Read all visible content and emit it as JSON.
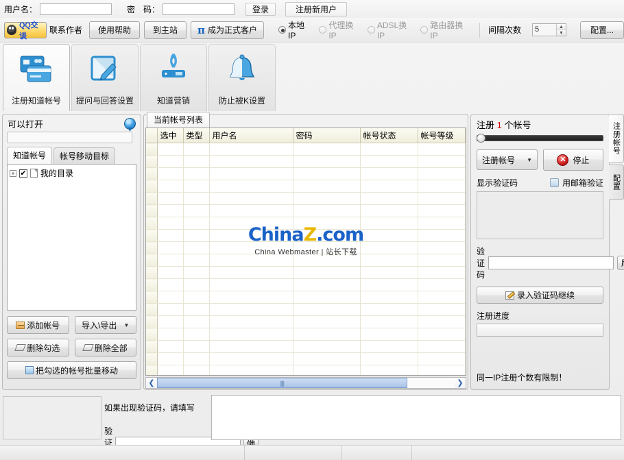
{
  "login": {
    "username_label": "用户名：",
    "username_value": "",
    "password_label": "密　码：",
    "password_value": "",
    "login_button": "登录",
    "register_button": "注册新用户"
  },
  "toolbar": {
    "qq_label": "QQ交谈",
    "contact_author": "联系作者",
    "help": "使用帮助",
    "main_site": "到主站",
    "become_client": "成为正式客户",
    "pi_symbol": "π",
    "ip_options": [
      {
        "label": "本地IP",
        "selected": true,
        "enabled": true
      },
      {
        "label": "代理换IP",
        "selected": false,
        "enabled": false
      },
      {
        "label": "ADSL换IP",
        "selected": false,
        "enabled": false
      },
      {
        "label": "路由器换IP",
        "selected": false,
        "enabled": false
      }
    ],
    "interval_label": "间隔次数",
    "interval_value": "5",
    "config_button": "配置..."
  },
  "main_tabs": [
    {
      "label": "注册知道帐号",
      "icon": "cards-icon",
      "active": true
    },
    {
      "label": "提问与回答设置",
      "icon": "note-pencil-icon",
      "active": false
    },
    {
      "label": "知道营销",
      "icon": "router-signal-icon",
      "active": false
    },
    {
      "label": "防止被K设置",
      "icon": "bell-icon",
      "active": false
    }
  ],
  "left_panel": {
    "title": "可以打开",
    "globe_icon": "globe-icon",
    "search_value": "",
    "subtabs": [
      {
        "label": "知道帐号",
        "active": true
      },
      {
        "label": "帐号移动目标",
        "active": false
      }
    ],
    "tree": [
      {
        "label": "我的目录",
        "checked": true,
        "expandable": true
      }
    ],
    "buttons": {
      "add_account": "添加帐号",
      "import_export": "导入\\导出",
      "delete_checked": "删除勾选",
      "delete_all": "删除全部",
      "batch_move": "把勾选的帐号批量移动"
    }
  },
  "center_panel": {
    "tab_label": "当前帐号列表",
    "columns": [
      "选中",
      "类型",
      "用户名",
      "密码",
      "帐号状态",
      "帐号等级"
    ],
    "rows": [],
    "watermark": {
      "brand_part1": "China",
      "brand_part2": "Z",
      "brand_part3": ".com",
      "subtitle": "China Webmaster | 站长下载"
    }
  },
  "right_panel": {
    "title_prefix": "注册",
    "title_count": "1",
    "title_suffix": "个帐号",
    "slider_value": 0,
    "action_select": "注册帐号",
    "stop_button": "停止",
    "show_captcha_label": "显示验证码",
    "email_verify_label": "用邮箱验证",
    "email_verify_checked": false,
    "captcha_label": "验证码",
    "captcha_value": "",
    "refresh_button": "刷",
    "continue_button": "录入验证码继续",
    "progress_label": "注册进度",
    "progress_value": "",
    "note": "同一IP注册个数有限制！"
  },
  "vertical_tabs": [
    {
      "label": "注册帐号",
      "active": true
    },
    {
      "label": "配置",
      "active": false
    }
  ],
  "bottom": {
    "hint": "如果出现验证码，请填写",
    "captcha_label": "验证码",
    "captcha_value": "",
    "ok_button": "确"
  },
  "colors": {
    "accent_blue": "#1a62c7",
    "brand_yellow": "#e8b800",
    "stop_red": "#cf1f1f",
    "count_red": "#cc0000"
  }
}
